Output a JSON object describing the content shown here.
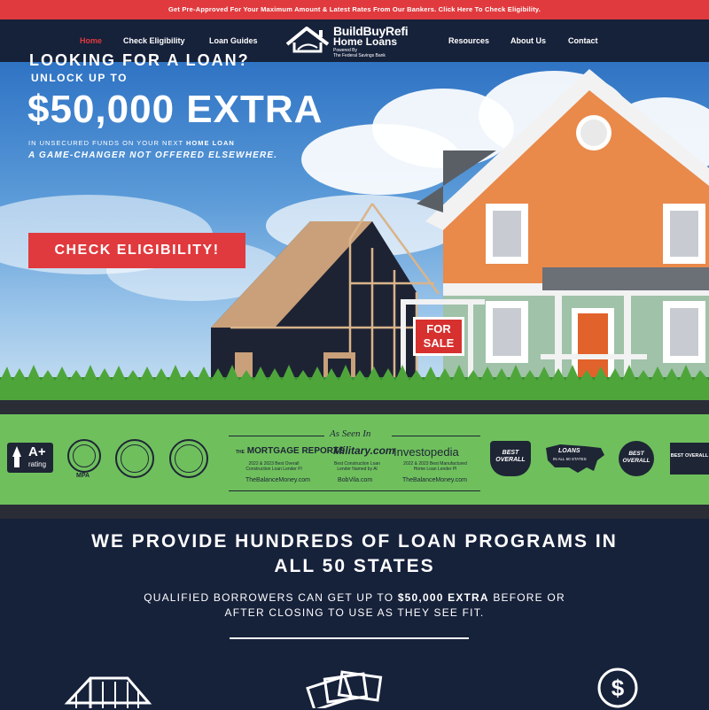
{
  "promo_bar": {
    "text": "Get Pre-Approved For Your Maximum Amount & Latest Rates From Our Bankers. Click Here To Check Eligibility."
  },
  "nav": {
    "items": [
      {
        "label": "Home",
        "active": true
      },
      {
        "label": "Check Eligibility"
      },
      {
        "label": "Loan Guides"
      },
      {
        "label": "Resources"
      },
      {
        "label": "About Us"
      },
      {
        "label": "Contact"
      }
    ],
    "logo": {
      "line1": "BuildBuyRefi",
      "line2": "Home Loans",
      "line3": "Powered By",
      "line4": "The Federal Savings Bank"
    }
  },
  "hero": {
    "line1": "LOOKING FOR A LOAN?",
    "line2": "UNLOCK UP TO",
    "amount": "$50,000 EXTRA",
    "line4_pre": "IN UNSECURED FUNDS ON YOUR NEXT ",
    "line4_bold": "HOME LOAN",
    "line5": "A GAME-CHANGER NOT OFFERED ELSEWHERE.",
    "cta_label": "CHECK ELIGIBILITY!",
    "sign_line1": "FOR",
    "sign_line2": "SALE"
  },
  "trust": {
    "bbb_rating": "A+",
    "bbb_rating_sub": "rating",
    "mpa": "MPA",
    "as_seen_in": "As Seen In",
    "pubs": [
      {
        "name": "MORTGAGE REPORTS",
        "name_pre": "THE",
        "desc": "2022 & 2023 Best Overall Construction Loan Lender Pl",
        "site": "TheBalanceMoney.com"
      },
      {
        "name": "Military.com",
        "desc": "Best Construction Loan Lender Named by Al",
        "site": "BobVila.com"
      },
      {
        "name": "Investopedia",
        "desc": "2022 & 2023 Best Manufactured Home Loan Lender Pl",
        "site": "TheBalanceMoney.com"
      }
    ],
    "awards": [
      {
        "top": "BEST",
        "main": "OVERALL"
      },
      {
        "main": "LOANS",
        "sub": "IN ALL 50 STATES"
      },
      {
        "top": "BEST",
        "main": "OVERALL"
      },
      {
        "top": "BEST OVERALL"
      }
    ]
  },
  "programs": {
    "title_line1": "WE PROVIDE HUNDREDS OF LOAN PROGRAMS IN",
    "title_line2": "ALL 50 STATES",
    "sub_line1_pre": "QUALIFIED BORROWERS CAN GET UP TO ",
    "sub_line1_bold": "$50,000 EXTRA",
    "sub_line1_post": " BEFORE OR",
    "sub_line2": "AFTER CLOSING TO USE AS THEY SEE FIT."
  },
  "colors": {
    "accent": "#e03a3e",
    "navy": "#16213a",
    "green": "#6fc05d"
  }
}
